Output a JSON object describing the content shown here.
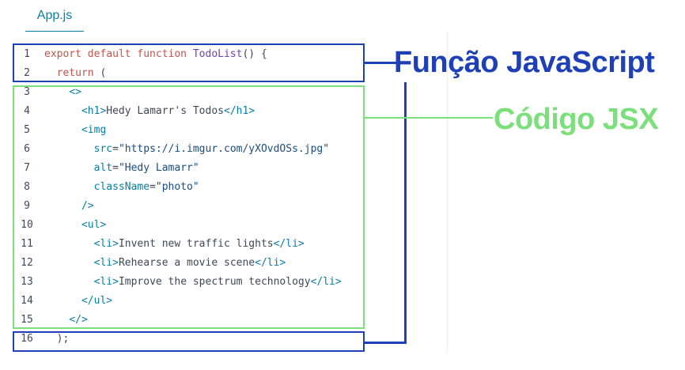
{
  "tab": {
    "label": "App.js"
  },
  "annotations": {
    "function_label": "Função JavaScript",
    "jsx_label": "Código JSX",
    "function_color": "#1d3fb8",
    "jsx_color": "#7be07b"
  },
  "code": {
    "lines": [
      {
        "n": "1",
        "segs": [
          [
            "kw",
            "export default function "
          ],
          [
            "fn",
            "TodoList"
          ],
          [
            "p",
            "() {"
          ]
        ]
      },
      {
        "n": "2",
        "segs": [
          [
            "p",
            "  "
          ],
          [
            "kw",
            "return"
          ],
          [
            "p",
            " ("
          ]
        ]
      },
      {
        "n": "3",
        "segs": [
          [
            "p",
            "    "
          ],
          [
            "tag",
            "<>"
          ]
        ]
      },
      {
        "n": "4",
        "segs": [
          [
            "p",
            "      "
          ],
          [
            "tag",
            "<h1>"
          ],
          [
            "p",
            "Hedy Lamarr's Todos"
          ],
          [
            "tag",
            "</h1>"
          ]
        ]
      },
      {
        "n": "5",
        "segs": [
          [
            "p",
            "      "
          ],
          [
            "tag",
            "<img"
          ]
        ]
      },
      {
        "n": "6",
        "segs": [
          [
            "p",
            "        "
          ],
          [
            "tag",
            "src"
          ],
          [
            "p",
            "="
          ],
          [
            "str",
            "\"https://i.imgur.com/yXOvdOSs.jpg\""
          ]
        ]
      },
      {
        "n": "7",
        "segs": [
          [
            "p",
            "        "
          ],
          [
            "tag",
            "alt"
          ],
          [
            "p",
            "="
          ],
          [
            "str",
            "\"Hedy Lamarr\""
          ]
        ]
      },
      {
        "n": "8",
        "segs": [
          [
            "p",
            "        "
          ],
          [
            "tag",
            "className"
          ],
          [
            "p",
            "="
          ],
          [
            "str",
            "\"photo\""
          ]
        ]
      },
      {
        "n": "9",
        "segs": [
          [
            "p",
            "      "
          ],
          [
            "tag",
            "/>"
          ]
        ]
      },
      {
        "n": "10",
        "segs": [
          [
            "p",
            "      "
          ],
          [
            "tag",
            "<ul>"
          ]
        ]
      },
      {
        "n": "11",
        "segs": [
          [
            "p",
            "        "
          ],
          [
            "tag",
            "<li>"
          ],
          [
            "p",
            "Invent new traffic lights"
          ],
          [
            "tag",
            "</li>"
          ]
        ]
      },
      {
        "n": "12",
        "segs": [
          [
            "p",
            "        "
          ],
          [
            "tag",
            "<li>"
          ],
          [
            "p",
            "Rehearse a movie scene"
          ],
          [
            "tag",
            "</li>"
          ]
        ]
      },
      {
        "n": "13",
        "segs": [
          [
            "p",
            "        "
          ],
          [
            "tag",
            "<li>"
          ],
          [
            "p",
            "Improve the spectrum technology"
          ],
          [
            "tag",
            "</li>"
          ]
        ]
      },
      {
        "n": "14",
        "segs": [
          [
            "p",
            "      "
          ],
          [
            "tag",
            "</ul>"
          ]
        ]
      },
      {
        "n": "15",
        "segs": [
          [
            "p",
            "    "
          ],
          [
            "tag",
            "</>"
          ]
        ]
      },
      {
        "n": "16",
        "segs": [
          [
            "p",
            "  );"
          ]
        ]
      }
    ]
  }
}
